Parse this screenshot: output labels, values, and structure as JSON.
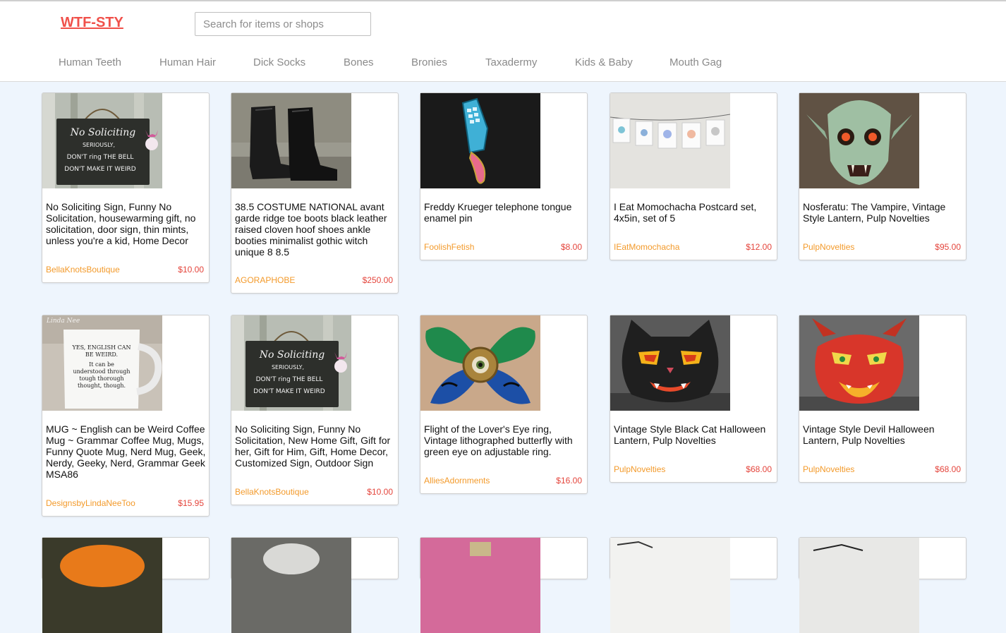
{
  "header": {
    "logo": "WTF-STY",
    "search_placeholder": "Search for items or shops"
  },
  "nav": [
    "Human Teeth",
    "Human Hair",
    "Dick Socks",
    "Bones",
    "Bronies",
    "Taxadermy",
    "Kids & Baby",
    "Mouth Gag"
  ],
  "listings": [
    {
      "title": "No Soliciting Sign, Funny No Solicitation, housewarming gift, no solicitation, door sign, thin mints, unless you're a kid, Home Decor",
      "shop": "BellaKnotsBoutique",
      "price": "$10.00",
      "image": "no-soliciting-sign",
      "sign_lines": [
        "No Soliciting",
        "SERIOUSLY,",
        "DON'T ring THE BELL",
        "DON'T MAKE IT WEIRD"
      ]
    },
    {
      "title": "38.5 COSTUME NATIONAL avant garde ridge toe boots black leather raised cloven hoof shoes ankle booties minimalist gothic witch unique 8 8.5",
      "shop": "AGORAPHOBE",
      "price": "$250.00",
      "image": "black-boots"
    },
    {
      "title": "Freddy Krueger telephone tongue enamel pin",
      "shop": "FoolishFetish",
      "price": "$8.00",
      "image": "telephone-pin"
    },
    {
      "title": "I Eat Momochacha Postcard set, 4x5in, set of 5",
      "shop": "IEatMomochacha",
      "price": "$12.00",
      "image": "postcards-on-line"
    },
    {
      "title": "Nosferatu: The Vampire, Vintage Style Lantern, Pulp Novelties",
      "shop": "PulpNovelties",
      "price": "$95.00",
      "image": "nosferatu-lantern"
    },
    {
      "title": "MUG ~ English can be Weird Coffee Mug ~ Grammar Coffee Mug, Mugs, Funny Quote Mug, Nerd Mug, Geek, Nerdy, Geeky, Nerd, Grammar Geek MSA86",
      "shop": "DesignsbyLindaNeeToo",
      "price": "$15.95",
      "image": "grammar-mug",
      "watermark": "Linda Nee",
      "mug_lines": [
        "YES, ENGLISH CAN",
        "BE WEIRD.",
        "It can be",
        "understood through",
        "tough thorough",
        "thought, though."
      ]
    },
    {
      "title": "No Soliciting Sign, Funny No Solicitation, New Home Gift, Gift for her, Gift for Him, Gift, Home Decor, Customized Sign, Outdoor Sign",
      "shop": "BellaKnotsBoutique",
      "price": "$10.00",
      "image": "no-soliciting-sign",
      "sign_lines": [
        "No Soliciting",
        "SERIOUSLY,",
        "DON'T ring THE BELL",
        "DON'T MAKE IT WEIRD"
      ]
    },
    {
      "title": "Flight of the Lover's Eye ring, Vintage lithographed butterfly with green eye on adjustable ring.",
      "shop": "AlliesAdornments",
      "price": "$16.00",
      "image": "butterfly-eye-ring"
    },
    {
      "title": "Vintage Style Black Cat Halloween Lantern, Pulp Novelties",
      "shop": "PulpNovelties",
      "price": "$68.00",
      "image": "black-cat-lantern"
    },
    {
      "title": "Vintage Style Devil Halloween Lantern, Pulp Novelties",
      "shop": "PulpNovelties",
      "price": "$68.00",
      "image": "devil-lantern"
    },
    {
      "title": "",
      "shop": "",
      "price": "",
      "image": "pumpkin-partial"
    },
    {
      "title": "",
      "shop": "",
      "price": "",
      "image": "gray-mask-partial"
    },
    {
      "title": "",
      "shop": "",
      "price": "",
      "image": "pink-item-partial"
    },
    {
      "title": "",
      "shop": "",
      "price": "",
      "image": "white-card-partial"
    },
    {
      "title": "",
      "shop": "",
      "price": "",
      "image": "white-item-partial"
    }
  ],
  "colors": {
    "logo": "#f0504a",
    "shop_link": "#f39a2b",
    "price": "#e4443b",
    "page_background": "#eef5fd",
    "nav_text": "#8a8a8a"
  }
}
